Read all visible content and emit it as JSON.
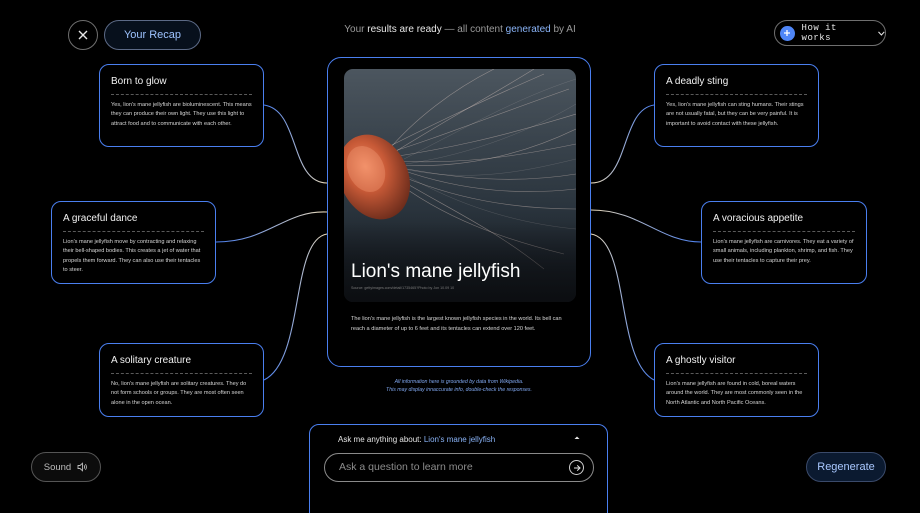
{
  "header": {
    "recap_label": "Your Recap",
    "headline": {
      "p1": "Your",
      "p2": "results are ready",
      "p3": "— all content",
      "p4": "generated",
      "p5": "by AI"
    },
    "how_it_works_label": "How it works"
  },
  "main": {
    "title": "Lion's mane jellyfish",
    "credit": "Source: gettyimages.com/detail/1735465?Photo by Jon 10.09 10",
    "description": "The lion's mane jellyfish is the largest known jellyfish species in the world. Its bell can reach a diameter of up to 6 feet and its tentacles can extend over 120 feet.",
    "disclaimer_line1": "All information here is grounded by data from Wikipedia.",
    "disclaimer_line2": "This may display innaccurate info, double-check the responses."
  },
  "facts": [
    {
      "title": "Born to glow",
      "text": "Yes, lion's mane jellyfish are bioluminescent. This means they can produce their own light. They use this light to attract food and to communicate with each other."
    },
    {
      "title": "A graceful dance",
      "text": "Lion's mane jellyfish move by contracting and relaxing their bell-shaped bodies. This creates a jet of water that propels them forward. They can also use their tentacles to steer."
    },
    {
      "title": "A solitary creature",
      "text": "No, lion's mane jellyfish are solitary creatures. They do not form schools or groups. They are most often seen alone in the open ocean."
    },
    {
      "title": "A deadly sting",
      "text": "Yes, lion's mane jellyfish can sting humans. Their stings are not usually fatal, but they can be very painful. It is important to avoid contact with these jellyfish."
    },
    {
      "title": "A voracious appetite",
      "text": "Lion's mane jellyfish are carnivores. They eat a variety of small animals, including plankton, shrimp, and fish. They use their tentacles to capture their prey."
    },
    {
      "title": "A ghostly visitor",
      "text": "Lion's mane jellyfish are found in cold, boreal waters around the world. They are most commonly seen in the North Atlantic and North Pacific Oceans."
    }
  ],
  "chat": {
    "ask_prefix": "Ask me anything about:",
    "ask_topic": "Lion's mane jellyfish",
    "placeholder": "Ask a question to learn more"
  },
  "footer": {
    "sound_label": "Sound",
    "regenerate_label": "Regenerate"
  },
  "colors": {
    "accent_border": "#4a7ff0",
    "link_blue": "#8ab4f8",
    "background": "#000000"
  },
  "icons": [
    "close-icon",
    "plus-icon",
    "chevron-down-icon",
    "chevron-up-icon",
    "arrow-right-icon",
    "speaker-icon"
  ]
}
